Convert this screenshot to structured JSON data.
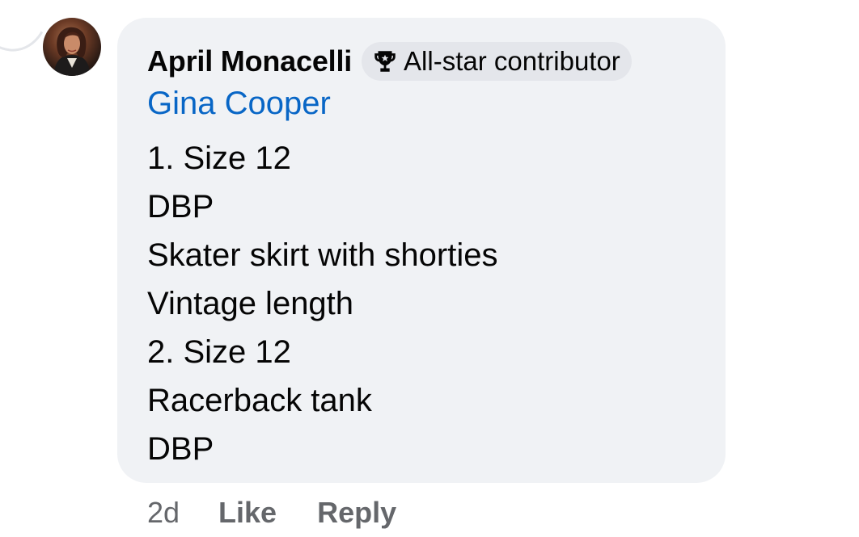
{
  "comment": {
    "author": "April Monacelli",
    "badge": {
      "icon": "trophy-icon",
      "label": "All-star contributor"
    },
    "mention": "Gina Cooper",
    "lines": [
      "1. Size 12",
      "DBP",
      "Skater skirt with shorties",
      "Vintage length",
      "2. Size 12",
      "Racerback tank",
      "DBP"
    ],
    "timestamp": "2d",
    "actions": {
      "like": "Like",
      "reply": "Reply"
    }
  },
  "colors": {
    "bubble": "#f0f2f5",
    "badge": "#e4e6eb",
    "mention": "#0866c6",
    "meta": "#65676b"
  }
}
